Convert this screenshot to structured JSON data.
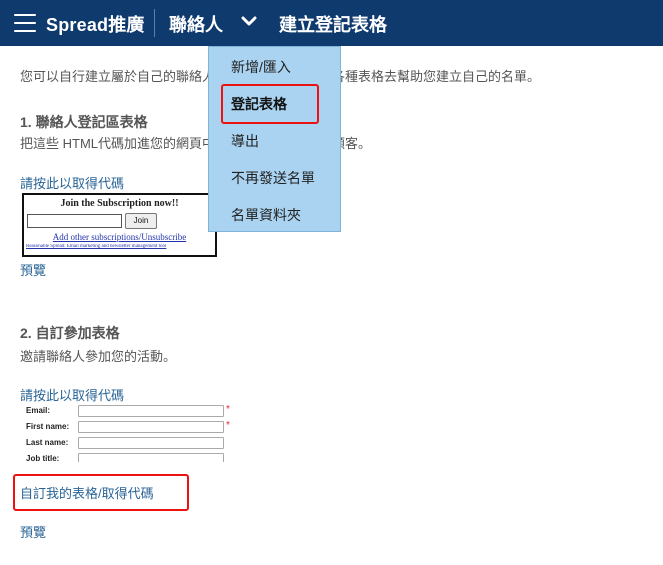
{
  "header": {
    "brand": "Spread推廣",
    "nav_contacts": "聯絡人",
    "nav_current": "建立登記表格"
  },
  "dropdown": {
    "items": [
      {
        "label": "新增/匯入"
      },
      {
        "label": "登記表格"
      },
      {
        "label": "導出"
      },
      {
        "label": "不再發送名單"
      },
      {
        "label": "名單資料夾"
      }
    ]
  },
  "intro": "您可以自行建立屬於自己的聯絡人登記表格，以及使用各種表格去幫助您建立自己的名單。",
  "sections": [
    {
      "title": "1. 聯絡人登記區表格",
      "desc": "把這些 HTML代碼加進您的網頁中，就能收集更多您的顧客。",
      "code_link": "請按此以取得代碼",
      "preview_link": "預覽",
      "widget": {
        "title": "Join the Subscription now!!",
        "button": "Join",
        "link": "Add other subscriptions/Unsubscribe",
        "footer": "Reasonable Spread: Email marketing and newsletter management tool"
      }
    },
    {
      "title": "2. 自訂參加表格",
      "desc": "邀請聯絡人參加您的活動。",
      "code_link": "請按此以取得代碼",
      "custom_link": "自訂我的表格/取得代碼",
      "preview_link": "預覽",
      "form_fields": [
        {
          "label": "Email:",
          "required": "*"
        },
        {
          "label": "First name:",
          "required": "*"
        },
        {
          "label": "Last name:",
          "required": ""
        },
        {
          "label": "Job title:",
          "required": ""
        }
      ]
    }
  ]
}
